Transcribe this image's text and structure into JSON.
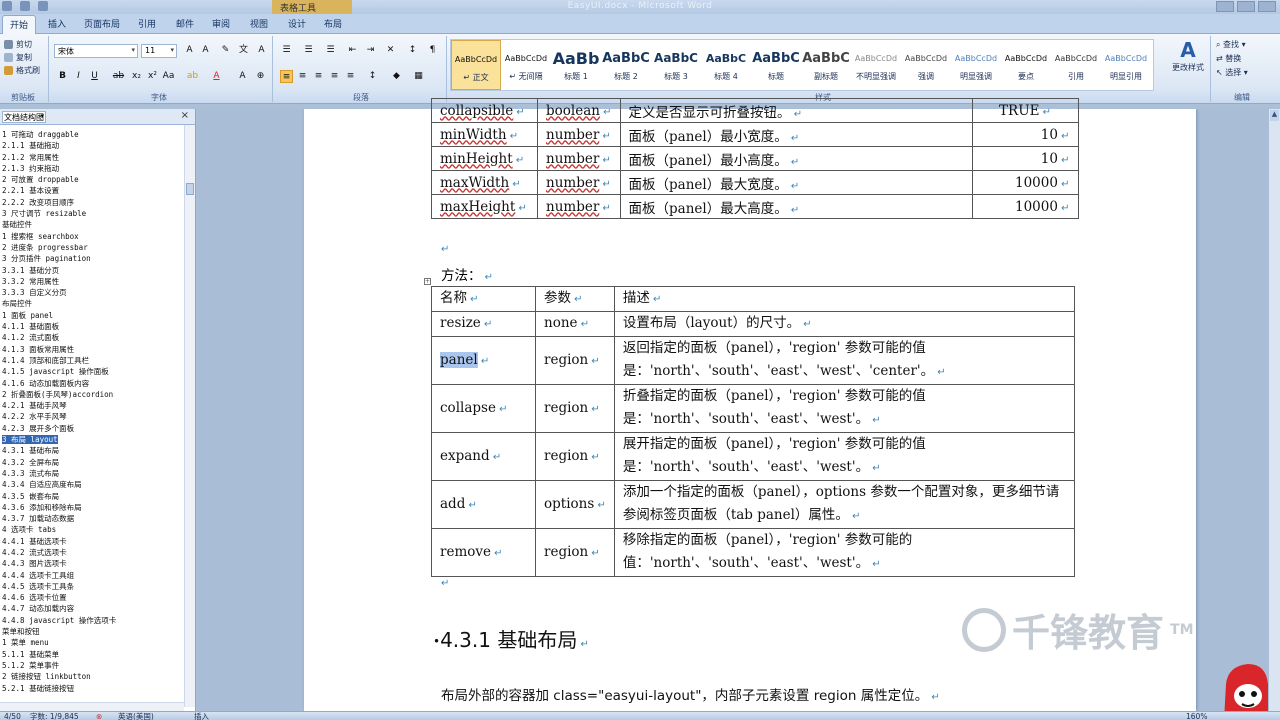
{
  "window": {
    "title": "EasyUI.docx - Microsoft Word",
    "context_tab": "表格工具"
  },
  "tabs": [
    "开始",
    "插入",
    "页面布局",
    "引用",
    "邮件",
    "审阅",
    "视图",
    "设计",
    "布局"
  ],
  "ribbon": {
    "clipboard": {
      "cut": "剪切",
      "copy": "复制",
      "format_painter": "格式刷",
      "label": "剪贴板"
    },
    "font": {
      "name": "宋体",
      "size": "11",
      "label": "字体"
    },
    "paragraph": {
      "label": "段落"
    },
    "styles": {
      "label": "样式",
      "items": [
        {
          "sample": "AaBbCcDd",
          "name": "↵ 正文"
        },
        {
          "sample": "AaBbCcDd",
          "name": "↵ 无间隔"
        },
        {
          "sample": "AaBb",
          "name": "标题 1"
        },
        {
          "sample": "AaBbC",
          "name": "标题 2"
        },
        {
          "sample": "AaBbC",
          "name": "标题 3"
        },
        {
          "sample": "AaBbC",
          "name": "标题 4"
        },
        {
          "sample": "AaBbC",
          "name": "标题"
        },
        {
          "sample": "AaBbC",
          "name": "副标题"
        },
        {
          "sample": "AaBbCcDd",
          "name": "不明显强调"
        },
        {
          "sample": "AaBbCcDd",
          "name": "强调"
        },
        {
          "sample": "AaBbCcDd",
          "name": "明显强调"
        },
        {
          "sample": "AaBbCcDd",
          "name": "要点"
        },
        {
          "sample": "AaBbCcDd",
          "name": "引用"
        },
        {
          "sample": "AaBbCcDd",
          "name": "明显引用"
        }
      ],
      "change_styles": "更改样式"
    },
    "editing": {
      "find": "查找",
      "replace": "替换",
      "select": "选择",
      "label": "编辑"
    }
  },
  "nav": {
    "mode": "文档结构图",
    "items": [
      "1 可拖动 draggable",
      "2.1.1 基础拖动",
      "2.1.2 常用属性",
      "2.1.3 约束拖动",
      "2 可放置 droppable",
      "2.2.1 基本设置",
      "2.2.2 改变项目顺序",
      "3 尺寸调节 resizable",
      "基础控件",
      "1 搜索框 searchbox",
      "2 进度条 progressbar",
      "3 分页插件 pagination",
      "3.3.1 基础分页",
      "3.3.2 常用属性",
      "3.3.3 自定义分页",
      "布局控件",
      "1 面板 panel",
      "4.1.1 基础面板",
      "4.1.2 流式面板",
      "4.1.3 面板常用属性",
      "4.1.4 顶部和底部工具栏",
      "4.1.5 javascript 操作面板",
      "4.1.6 动态加载面板内容",
      "2 折叠面板(手风琴)accordion",
      "4.2.1 基础手风琴",
      "4.2.2 水平手风琴",
      "4.2.3 展开多个面板",
      "3 布局 layout",
      "4.3.1 基础布局",
      "4.3.2 全屏布局",
      "4.3.3 流式布局",
      "4.3.4 自适应高度布局",
      "4.3.5 嵌套布局",
      "4.3.6 添加和移除布局",
      "4.3.7 加载动态数据",
      "4 选项卡 tabs",
      "4.4.1 基础选项卡",
      "4.4.2 流式选项卡",
      "4.4.3 图片选项卡",
      "4.4.4 选项卡工具组",
      "4.4.5 选项卡工具条",
      "4.4.6 选项卡位置",
      "4.4.7 动态加载内容",
      "4.4.8 javascript 操作选项卡",
      "菜单和按钮",
      "1 菜单 menu",
      "5.1.1 基础菜单",
      "5.1.2 菜单事件",
      "2 链接按钮 linkbutton",
      "5.2.1 基础链接按钮"
    ],
    "selected_index": 27
  },
  "props_table": {
    "rows": [
      [
        "collapsible",
        "boolean",
        "定义是否显示可折叠按钮。",
        "TRUE"
      ],
      [
        "minWidth",
        "number",
        "面板（panel）最小宽度。",
        "10"
      ],
      [
        "minHeight",
        "number",
        "面板（panel）最小高度。",
        "10"
      ],
      [
        "maxWidth",
        "number",
        "面板（panel）最大宽度。",
        "10000"
      ],
      [
        "maxHeight",
        "number",
        "面板（panel）最大高度。",
        "10000"
      ]
    ]
  },
  "methods": {
    "label": "方法：",
    "headers": [
      "名称",
      "参数",
      "描述"
    ],
    "rows": [
      [
        "resize",
        "none",
        "设置布局（layout）的尺寸。"
      ],
      [
        "panel",
        "region",
        "返回指定的面板（panel），'region' 参数可能的值是：'north'、'south'、'east'、'west'、'center'。"
      ],
      [
        "collapse",
        "region",
        "折叠指定的面板（panel），'region' 参数可能的值是：'north'、'south'、'east'、'west'。"
      ],
      [
        "expand",
        "region",
        "展开指定的面板（panel），'region' 参数可能的值是：'north'、'south'、'east'、'west'。"
      ],
      [
        "add",
        "options",
        "添加一个指定的面板（panel），options 参数一个配置对象，更多细节请参阅标签页面板（tab panel）属性。"
      ],
      [
        "remove",
        "region",
        "移除指定的面板（panel），'region' 参数可能的值：'north'、'south'、'east'、'west'。"
      ]
    ]
  },
  "section": {
    "heading": "4.3.1 基础布局",
    "body": "布局外部的容器加 class=\"easyui-layout\"，内部子元素设置 region 属性定位。"
  },
  "watermark": {
    "text": "千锋教育",
    "tm": "TM"
  },
  "status": {
    "page": "4/50",
    "words": "字数: 1/9,845",
    "lang": "英语(美国)",
    "mode": "插入",
    "zoom": "160%"
  },
  "colors": {
    "ribbon_bg": "#dbe6f4",
    "nav_highlight": "#3367b3",
    "selection": "#a9c6ee",
    "context_tab": "#d9b45c"
  }
}
